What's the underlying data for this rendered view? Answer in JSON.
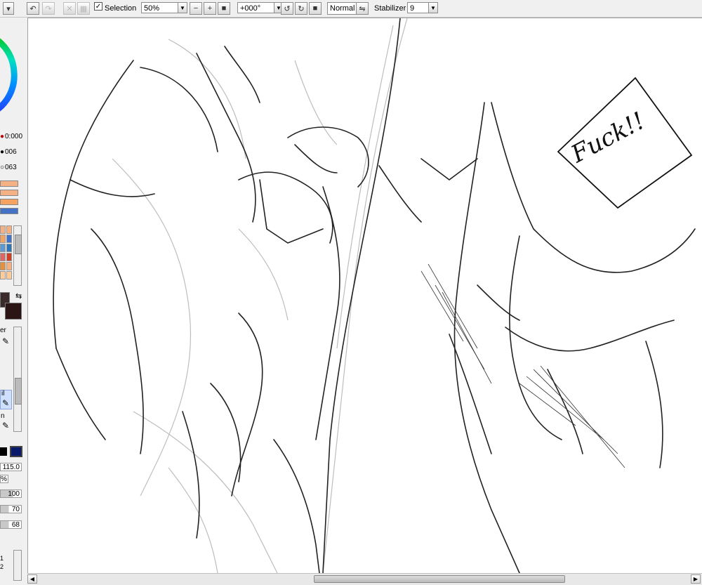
{
  "toolbar": {
    "selection_label": "Selection",
    "selection_checked": "✓",
    "zoom_value": "50%",
    "rotation_value": "+000°",
    "blend_mode": "Normal",
    "stabilizer_label": "Stabilizer",
    "stabilizer_value": "9"
  },
  "left_panel": {
    "nav_values": [
      "0:000",
      "006",
      "063"
    ],
    "tool_label_1": "er",
    "tool_label_2": "il",
    "tool_label_3": "n",
    "brush_size": "115.0",
    "percent_label": "%",
    "density_values": [
      "100",
      "70",
      "68"
    ],
    "bottom_values": [
      "1",
      "2"
    ]
  },
  "canvas": {
    "sfx_text": "Fuck!!"
  },
  "colors": {
    "foreground": "#3a2a2a",
    "background": "#2a1414",
    "swatches": [
      "#f4b183",
      "#f4b183",
      "#f4a460",
      "#4472c4",
      "#5b9bd5",
      "#2e75b6",
      "#e06666",
      "#cc4125",
      "#e69138",
      "#f4b183",
      "#ffcc99",
      "#ffcc99"
    ]
  }
}
